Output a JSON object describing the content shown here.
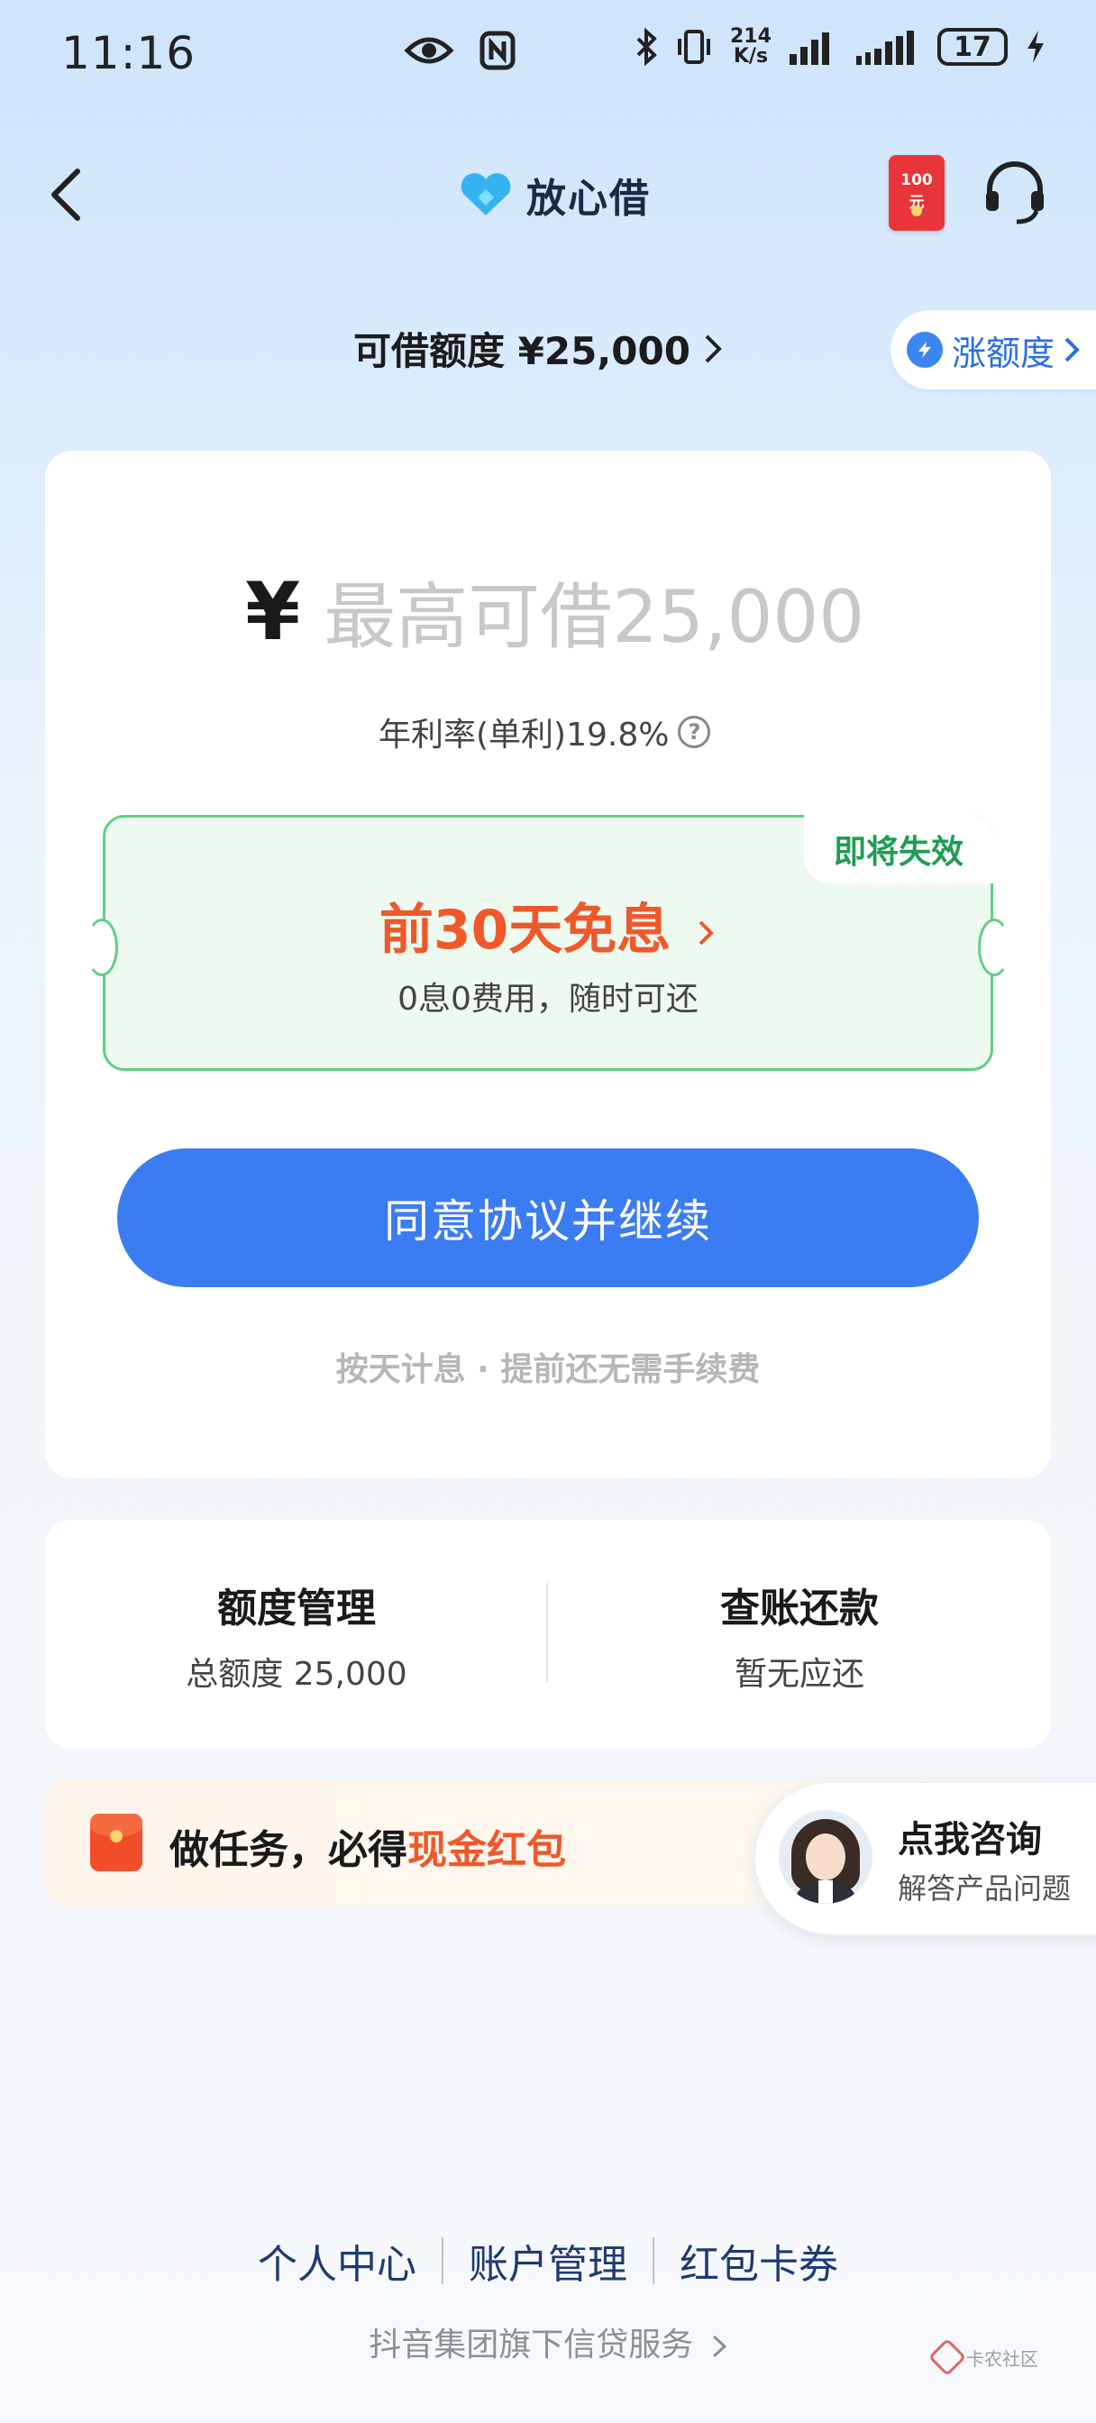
{
  "status": {
    "time": "11:16",
    "speed_value": "214",
    "speed_unit": "K/s",
    "battery": "17"
  },
  "header": {
    "title": "放心借",
    "redpacket_label": "100元"
  },
  "limit": {
    "text": "可借额度 ¥25,000",
    "raise_label": "涨额度"
  },
  "loan": {
    "currency": "¥",
    "placeholder": "最高可借25,000",
    "rate_text": "年利率(单利)19.8%",
    "help": "?"
  },
  "promo": {
    "badge": "即将失效",
    "title": "前30天免息",
    "subtitle": "0息0费用，随时可还"
  },
  "agree_button": "同意协议并继续",
  "agree_note": "按天计息 · 提前还无需手续费",
  "manage": {
    "quota_title": "额度管理",
    "quota_sub": "总额度 25,000",
    "bill_title": "查账还款",
    "bill_sub": "暂无应还"
  },
  "task": {
    "text": "做任务，必得",
    "highlight": "现金红包"
  },
  "consult": {
    "title": "点我咨询",
    "subtitle": "解答产品问题"
  },
  "footer": {
    "links": [
      "个人中心",
      "账户管理",
      "红包卡券"
    ],
    "note": "抖音集团旗下信贷服务",
    "watermark": "卡农社区"
  },
  "colors": {
    "primary_button": "#3c7cf2",
    "promo_green": "#5fcf85",
    "promo_orange": "#f0582a"
  }
}
